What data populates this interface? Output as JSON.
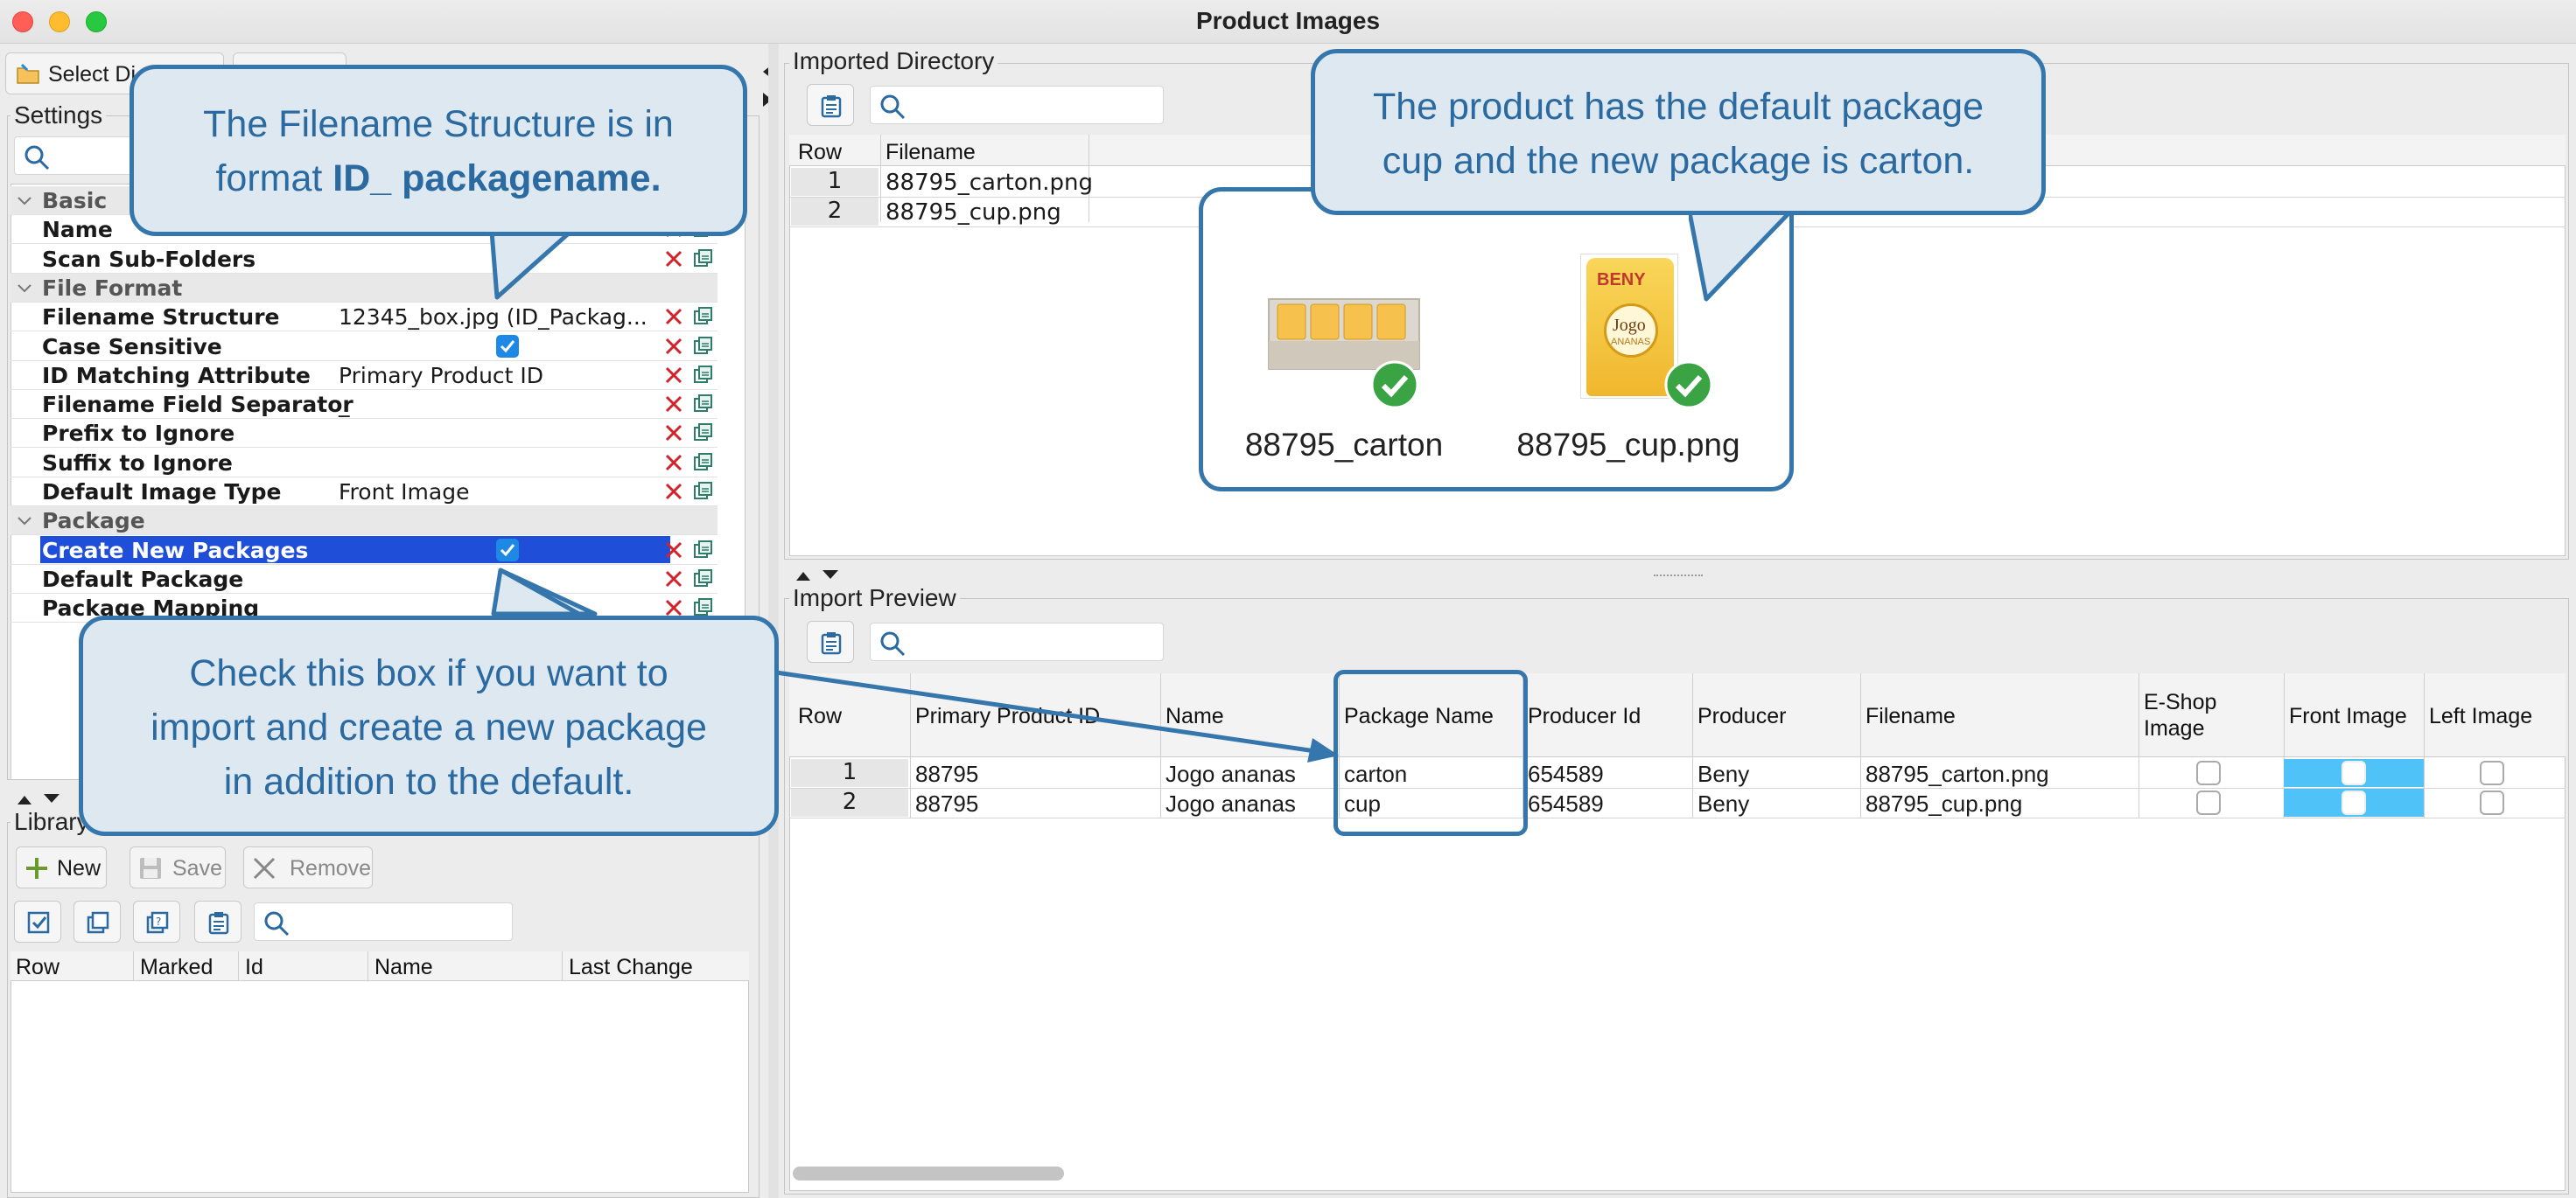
{
  "window": {
    "title": "Product Images"
  },
  "colors": {
    "accent": "#1e88e5",
    "selection": "#1f4fd8",
    "callout_border": "#3576ad",
    "callout_fill": "#dde8f1",
    "cell_highlight": "#4fc3f7"
  },
  "toolbar": {
    "select_dir_label": "Select Di"
  },
  "settings": {
    "title": "Settings",
    "rows": [
      {
        "type": "category",
        "label": "Basic"
      },
      {
        "type": "prop",
        "label": "Name",
        "value": ""
      },
      {
        "type": "prop",
        "label": "Scan Sub-Folders",
        "value": ""
      },
      {
        "type": "category",
        "label": "File Format"
      },
      {
        "type": "prop",
        "label": "Filename Structure",
        "value": "12345_box.jpg (ID_Packag..."
      },
      {
        "type": "prop",
        "label": "Case Sensitive",
        "value": "",
        "checked": true
      },
      {
        "type": "prop",
        "label": "ID Matching Attribute",
        "value": "Primary Product ID"
      },
      {
        "type": "prop",
        "label": "Filename Field Separator",
        "value": "_"
      },
      {
        "type": "prop",
        "label": "Prefix to Ignore",
        "value": ""
      },
      {
        "type": "prop",
        "label": "Suffix to Ignore",
        "value": ""
      },
      {
        "type": "prop",
        "label": "Default Image Type",
        "value": "Front Image"
      },
      {
        "type": "category",
        "label": "Package"
      },
      {
        "type": "prop",
        "label": "Create New Packages",
        "value": "",
        "checked": true,
        "selected": true
      },
      {
        "type": "prop",
        "label": "Default Package",
        "value": ""
      },
      {
        "type": "prop",
        "label": "Package Mapping",
        "value": ""
      }
    ]
  },
  "library": {
    "title": "Library",
    "buttons": {
      "new": "New",
      "save": "Save",
      "remove": "Remove"
    },
    "columns": [
      "Row",
      "Marked",
      "Id",
      "Name",
      "Last Change"
    ]
  },
  "imported_directory": {
    "title": "Imported Directory",
    "columns": [
      "Row",
      "Filename"
    ],
    "rows": [
      {
        "row": "1",
        "filename": "88795_carton.png"
      },
      {
        "row": "2",
        "filename": "88795_cup.png"
      }
    ],
    "thumbnails": [
      {
        "label": "88795_carton",
        "icon": "carton-image"
      },
      {
        "label": "88795_cup.png",
        "icon": "cup-image",
        "brand": "BENY",
        "product": "Jogo",
        "sub": "ANANAS"
      }
    ]
  },
  "import_preview": {
    "title": "Import Preview",
    "columns": [
      "Row",
      "Primary Product ID",
      "Name",
      "Package Name",
      "Producer Id",
      "Producer",
      "Filename",
      "E-Shop Image",
      "Front Image",
      "Left Image"
    ],
    "rows": [
      {
        "row": "1",
        "ppid": "88795",
        "name": "Jogo ananas",
        "package": "carton",
        "producer_id": "654589",
        "producer": "Beny",
        "filename": "88795_carton.png"
      },
      {
        "row": "2",
        "ppid": "88795",
        "name": "Jogo ananas",
        "package": "cup",
        "producer_id": "654589",
        "producer": "Beny",
        "filename": "88795_cup.png"
      }
    ]
  },
  "callouts": {
    "c1_line1": "The Filename Structure is in",
    "c1_line2a": "format ",
    "c1_line2b": "ID_ packagename.",
    "c2_line1": "The product has the default package",
    "c2_line2": "cup and the new package is carton.",
    "c3_line1": "Check this box if you want to",
    "c3_line2": "import and create a new package",
    "c3_line3": "in addition to the default."
  }
}
